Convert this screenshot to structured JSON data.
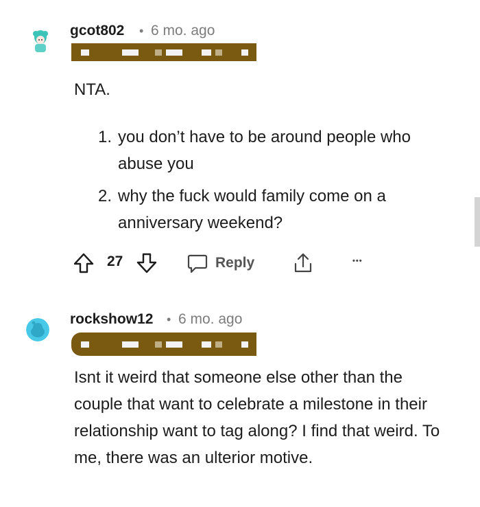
{
  "comments": [
    {
      "username": "gcot802",
      "separator": "•",
      "time": "6 mo. ago",
      "body_intro": "NTA.",
      "list": [
        {
          "num": "1.",
          "text": "you don’t have to be around people who abuse you"
        },
        {
          "num": "2.",
          "text": "why the fuck would family come on a anniversary weekend?"
        }
      ],
      "votes": "27",
      "reply_label": "Reply",
      "more_label": "•••"
    },
    {
      "username": "rockshow12",
      "separator": "•",
      "time": "6 mo. ago",
      "body": "Isnt it weird that someone else other than the couple that want to celebrate a milestone in their relationship want to tag along? I find that weird. To me, there was an ulterior motive."
    }
  ],
  "icons": {
    "upvote": "arrow-up-outline-icon",
    "downvote": "arrow-down-outline-icon",
    "reply": "speech-bubble-icon",
    "share": "share-upload-icon",
    "more": "ellipsis-icon"
  },
  "colors": {
    "flair_redaction": "#7a5a10",
    "avatar1": "#4fc7c0",
    "avatar2": "#49c9e8",
    "meta_gray": "#7c7c7c"
  }
}
